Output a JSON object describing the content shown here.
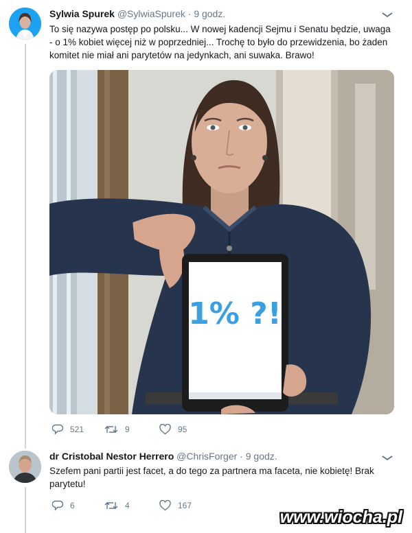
{
  "tweet1": {
    "name": "Sylwia Spurek",
    "handle": "@SylwiaSpurek",
    "separator": "·",
    "time": "9 godz.",
    "text": "To się nazywa postęp po polsku... W nowej kadencji Sejmu i Senatu będzie, uwaga - o 1% kobiet więcej niż w poprzedniej... Trochę to było do przewidzenia, bo żaden komitet nie miał ani parytetów na jedynkach, ani suwaka. Brawo!",
    "photo_sign_text": "1% ?!",
    "replies": "521",
    "retweets": "9",
    "likes": "95"
  },
  "tweet2": {
    "name": "dr Cristobal Nestor Herrero",
    "handle": "@ChrisForger",
    "separator": "·",
    "time": "9 godz.",
    "text": "Szefem pani partii jest facet, a do tego za partnera ma faceta, nie kobietę! Brak parytetu!",
    "replies": "6",
    "retweets": "4",
    "likes": "167"
  },
  "watermark": "www.wiocha.pl",
  "colors": {
    "accent": "#1da1f2",
    "muted": "#657786",
    "text": "#14171a"
  },
  "icons": [
    "chevron-down-icon",
    "reply-icon",
    "retweet-icon",
    "like-icon"
  ]
}
